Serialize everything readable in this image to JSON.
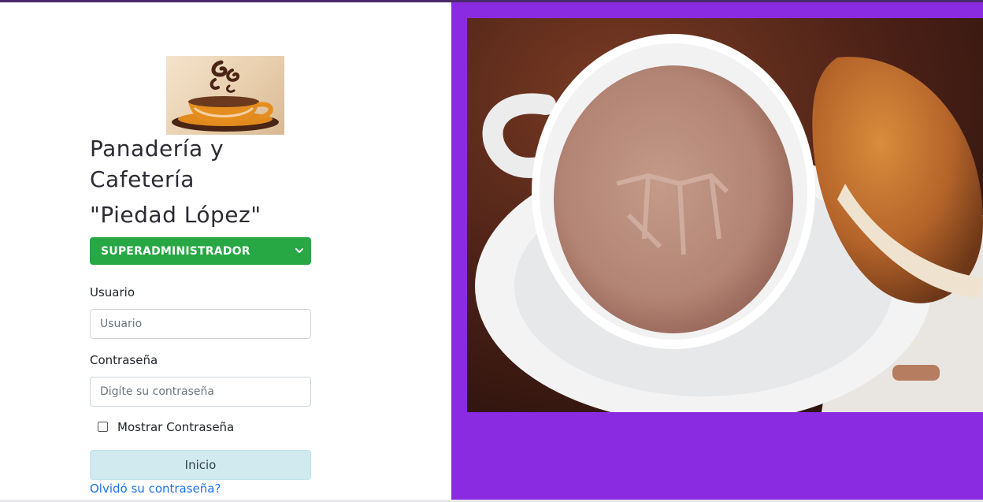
{
  "brand": {
    "line1": "Panadería y",
    "line2": "Cafetería",
    "line3": "\"Piedad López\""
  },
  "role_select": {
    "selected": "SUPERADMINISTRADOR"
  },
  "form": {
    "username_label": "Usuario",
    "username_placeholder": "Usuario",
    "password_label": "Contraseña",
    "password_placeholder": "Digíte su contraseña",
    "show_password_label": "Mostrar Contraseña",
    "submit_label": "Inicio",
    "forgot_label": "Olvidó su contraseña?"
  },
  "colors": {
    "accent_purple": "#8a2be2",
    "select_green": "#28a745",
    "button_bg": "#d1eaef",
    "link_blue": "#1a73e8"
  },
  "icons": {
    "logo": "coffee-cup-logo",
    "select_caret": "chevron-down-icon",
    "photo": "hot-chocolate-and-bread-photo"
  }
}
